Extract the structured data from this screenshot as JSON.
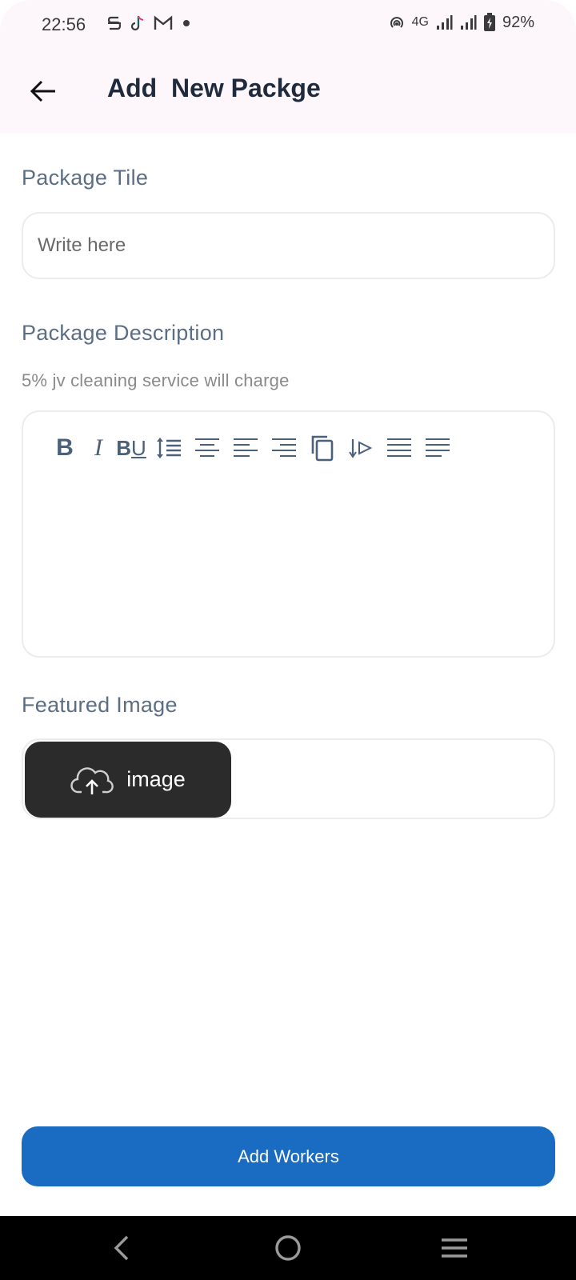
{
  "status_bar": {
    "time": "22:56",
    "left_icons": [
      "s-app-icon",
      "tiktok-icon",
      "gmail-icon",
      "dot-icon"
    ],
    "right_icons": [
      "hotspot-icon",
      "4g-icon",
      "signal-icon",
      "signal-icon",
      "battery-charging-icon"
    ],
    "network": "4G",
    "battery": "92%"
  },
  "app_bar": {
    "back_icon": "arrow-left-icon",
    "title": "Add  New Packge"
  },
  "form": {
    "title_label": "Package Tile",
    "title_placeholder": "Write here",
    "title_value": "",
    "description_label": "Package Description",
    "description_note": "5% jv cleaning service will charge",
    "description_value": "",
    "toolbar": [
      {
        "name": "bold-button",
        "icon": "bold-icon",
        "glyph": "B"
      },
      {
        "name": "italic-button",
        "icon": "italic-icon",
        "glyph": "I"
      },
      {
        "name": "bold-underline-button",
        "icon": "bold-underline-icon",
        "glyph": "BU"
      },
      {
        "name": "line-height-button",
        "icon": "line-height-icon"
      },
      {
        "name": "align-center-button",
        "icon": "align-center-icon"
      },
      {
        "name": "align-left-button",
        "icon": "align-left-icon"
      },
      {
        "name": "align-right-button",
        "icon": "align-right-icon"
      },
      {
        "name": "copy-button",
        "icon": "copy-icon"
      },
      {
        "name": "text-direction-button",
        "icon": "text-direction-icon"
      },
      {
        "name": "justify-button",
        "icon": "align-justify-icon"
      },
      {
        "name": "align-start-button",
        "icon": "align-start-icon"
      }
    ],
    "image_label": "Featured Image",
    "image_button_icon": "cloud-upload-icon",
    "image_button_label": "image"
  },
  "actions": {
    "submit_label": "Add Workers"
  },
  "system_nav": {
    "back_icon": "nav-back-icon",
    "home_icon": "nav-home-icon",
    "menu_icon": "nav-recents-icon"
  },
  "colors": {
    "app_bar_bg": "#fdf7fb",
    "title": "#1f2a3d",
    "label": "#5b6e84",
    "primary": "#1a6bc2",
    "upload_button_bg": "#2b2b2b"
  }
}
